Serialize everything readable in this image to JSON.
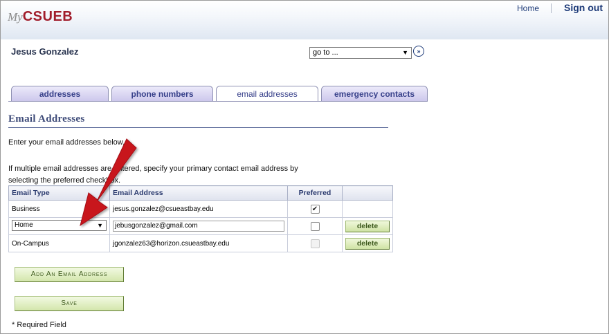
{
  "header": {
    "logo_my": "My",
    "logo_name": "CSUEB",
    "home_link": "Home",
    "signout_link": "Sign out"
  },
  "student": {
    "name": "Jesus Gonzalez"
  },
  "goto": {
    "selected": "go to ...",
    "go_icon": "double-chevron-right-icon",
    "go_glyph": "»"
  },
  "tabs": [
    {
      "label": "addresses",
      "active": false
    },
    {
      "label": "phone numbers",
      "active": false
    },
    {
      "label": "email addresses",
      "active": true
    },
    {
      "label": "emergency contacts",
      "active": false
    }
  ],
  "section": {
    "title": "Email Addresses",
    "intro": "Enter your email addresses below.",
    "instructions": "If multiple email addresses are entered, specify your primary contact email address by selecting the preferred checkbox."
  },
  "table": {
    "headers": {
      "type": "Email Type",
      "address": "Email Address",
      "preferred": "Preferred",
      "action": ""
    },
    "rows": [
      {
        "type": "Business",
        "address": "jesus.gonzalez@csueastbay.edu",
        "preferred": true,
        "preferred_enabled": true,
        "editable": false,
        "delete": ""
      },
      {
        "type": "Home",
        "address": "jebusgonzalez@gmail.com",
        "preferred": false,
        "preferred_enabled": true,
        "editable": true,
        "delete": "delete"
      },
      {
        "type": "On-Campus",
        "address": "jgonzalez63@horizon.csueastbay.edu",
        "preferred": false,
        "preferred_enabled": false,
        "editable": false,
        "delete": "delete"
      }
    ]
  },
  "buttons": {
    "add_email": "Add An Email Address",
    "save": "Save"
  },
  "footer": {
    "required_note": "* Required Field"
  },
  "colors": {
    "brand_red": "#a11d2b",
    "tab_purple": "#37408a",
    "button_green": "#d3e6ab",
    "annotation_arrow": "#c8161e"
  }
}
